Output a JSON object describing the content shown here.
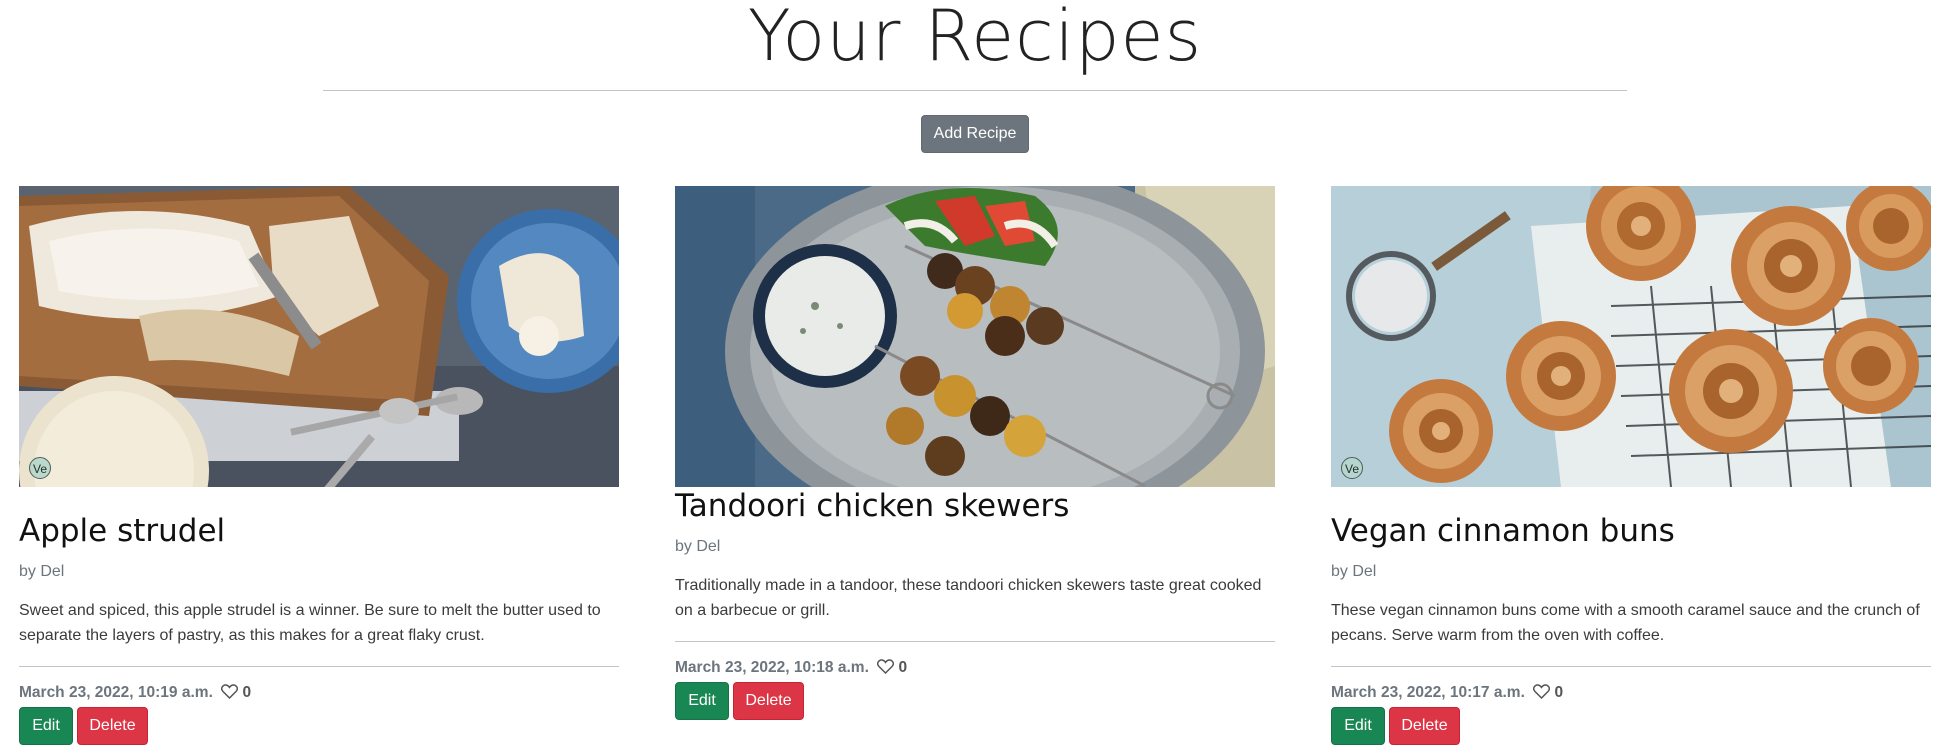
{
  "page": {
    "title": "Your Recipes",
    "add_button_label": "Add Recipe"
  },
  "recipes": [
    {
      "title": "Apple strudel",
      "author": "by Del",
      "description": "Sweet and spiced, this apple strudel is a winner. Be sure to melt the butter used to separate the layers of pastry, as this makes for a great flaky crust.",
      "date": "March 23, 2022, 10:19 a.m.",
      "likes": "0",
      "badge": "Ve",
      "edit_label": "Edit",
      "delete_label": "Delete",
      "image_icon": "apple-strudel-photo"
    },
    {
      "title": "Tandoori chicken skewers",
      "author": "by Del",
      "description": "Traditionally made in a tandoor, these tandoori chicken skewers taste great cooked on a barbecue or grill.",
      "date": "March 23, 2022, 10:18 a.m.",
      "likes": "0",
      "badge": "",
      "edit_label": "Edit",
      "delete_label": "Delete",
      "image_icon": "tandoori-skewers-photo"
    },
    {
      "title": "Vegan cinnamon buns",
      "author": "by Del",
      "description": "These vegan cinnamon buns come with a smooth caramel sauce and the crunch of pecans. Serve warm from the oven with coffee.",
      "date": "March 23, 2022, 10:17 a.m.",
      "likes": "0",
      "badge": "Ve",
      "edit_label": "Edit",
      "delete_label": "Delete",
      "image_icon": "cinnamon-buns-photo"
    }
  ],
  "colors": {
    "secondary_button": "#6c757d",
    "edit_button": "#198754",
    "delete_button": "#dc3545",
    "muted_text": "#6c757d"
  }
}
